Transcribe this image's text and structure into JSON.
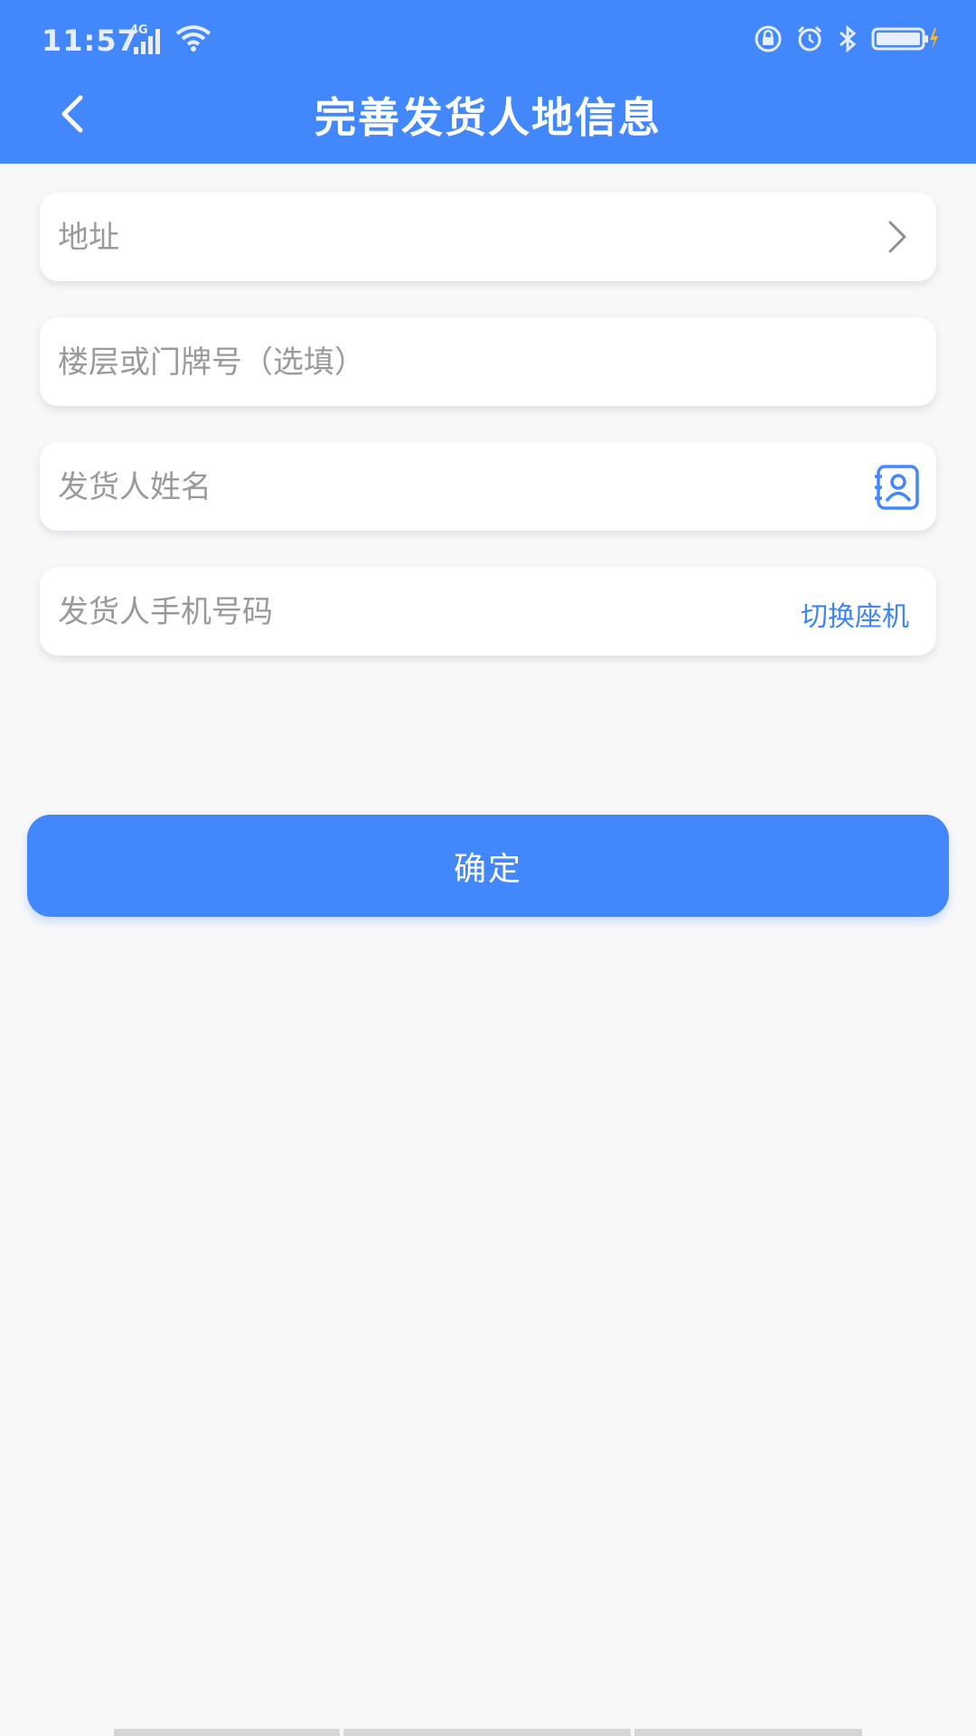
{
  "status_bar": {
    "time": "11:57",
    "network": "4G"
  },
  "header": {
    "title": "完善发货人地信息",
    "back_icon": "chevron-left-icon"
  },
  "form": {
    "address": {
      "placeholder": "地址",
      "icon": "chevron-right-icon"
    },
    "floor": {
      "placeholder": "楼层或门牌号（选填）"
    },
    "name": {
      "placeholder": "发货人姓名",
      "icon": "contacts-icon"
    },
    "phone": {
      "placeholder": "发货人手机号码",
      "switch_label": "切换座机"
    }
  },
  "confirm_button": {
    "label": "确定"
  },
  "colors": {
    "primary": "#4287fb",
    "link": "#3f85f7",
    "background": "#f8f8f9",
    "placeholder": "#9a9a9a"
  }
}
